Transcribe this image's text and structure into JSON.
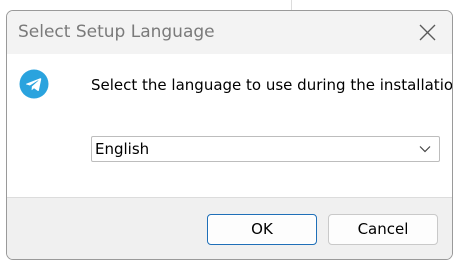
{
  "dialog": {
    "title": "Select Setup Language",
    "message": "Select the language to use during the installation.",
    "app_icon": "telegram-icon",
    "close_icon": "close-icon"
  },
  "language_select": {
    "selected": "English",
    "arrow_icon": "chevron-down-icon"
  },
  "buttons": {
    "ok_label": "OK",
    "cancel_label": "Cancel"
  },
  "colors": {
    "accent": "#1f6fb8",
    "icon_blue": "#2aa3de"
  }
}
